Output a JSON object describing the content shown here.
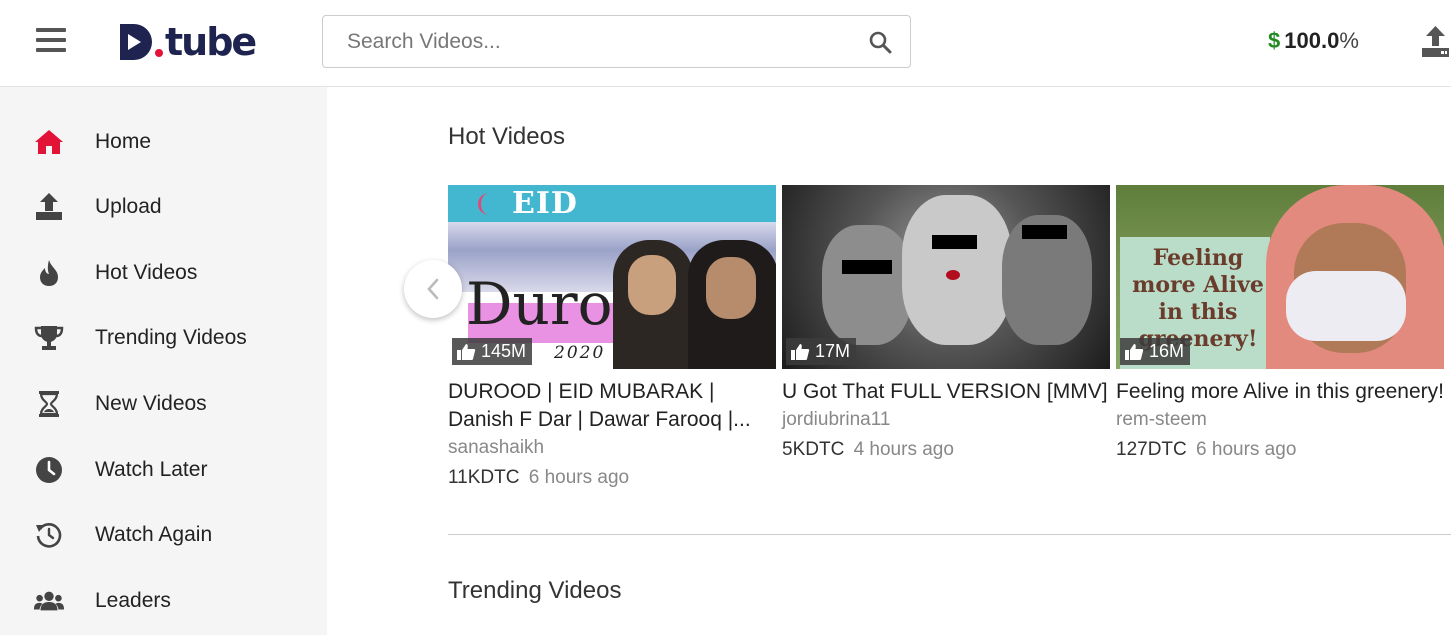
{
  "header": {
    "logo_text": "tube",
    "search_placeholder": "Search Videos...",
    "balance_value": "100.0",
    "balance_unit": "%",
    "currency_symbol": "$"
  },
  "sidebar": {
    "items": [
      {
        "label": "Home",
        "icon": "home-icon",
        "active": true
      },
      {
        "label": "Upload",
        "icon": "upload-icon"
      },
      {
        "label": "Hot Videos",
        "icon": "flame-icon"
      },
      {
        "label": "Trending Videos",
        "icon": "trophy-icon"
      },
      {
        "label": "New Videos",
        "icon": "hourglass-icon"
      },
      {
        "label": "Watch Later",
        "icon": "clock-icon"
      },
      {
        "label": "Watch Again",
        "icon": "history-icon"
      },
      {
        "label": "Leaders",
        "icon": "users-icon"
      }
    ]
  },
  "sections": {
    "hot_title": "Hot Videos",
    "trending_title": "Trending Videos"
  },
  "videos": [
    {
      "title": "DUROOD | EID MUBARAK | Danish F Dar | Dawar Farooq |...",
      "author": "sanashaikh",
      "likes": "145M",
      "value": "11KDTC",
      "time": "6 hours ago",
      "thumb_banner": "EID MUBARAKH",
      "thumb_word": "Durood",
      "thumb_year": "2020"
    },
    {
      "title": "U Got That FULL VERSION [MMV]",
      "author": "jordiubrina11",
      "likes": "17M",
      "value": "5KDTC",
      "time": "4 hours ago"
    },
    {
      "title": "Feeling more Alive in this greenery!",
      "author": "rem-steem",
      "likes": "16M",
      "value": "127DTC",
      "time": "6 hours ago",
      "thumb_sign": "Feeling more Alive in this greenery!"
    }
  ],
  "colors": {
    "accent": "#e31337",
    "brand": "#1f2350",
    "money": "#218b21"
  }
}
